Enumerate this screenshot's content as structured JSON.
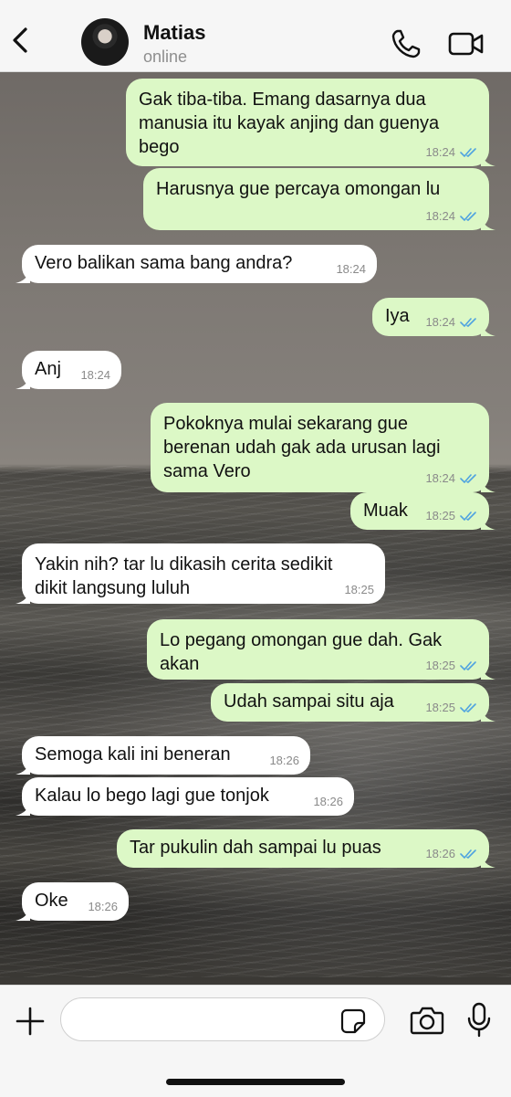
{
  "header": {
    "contact_name": "Matias",
    "status": "online",
    "icons": {
      "back": "chevron-left-icon",
      "call": "phone-icon",
      "video": "video-camera-icon"
    }
  },
  "messages": [
    {
      "dir": "out",
      "text": "Gak tiba-tiba. Emang dasarnya dua\nmanusia itu kayak anjing dan guenya\nbego",
      "time": "18:24",
      "read": true
    },
    {
      "dir": "out",
      "text": "Harusnya gue percaya omongan lu",
      "time": "18:24",
      "read": true
    },
    {
      "dir": "in",
      "text": "Vero balikan sama bang andra?",
      "time": "18:24"
    },
    {
      "dir": "out",
      "text": "Iya",
      "time": "18:24",
      "read": true
    },
    {
      "dir": "in",
      "text": "Anj",
      "time": "18:24"
    },
    {
      "dir": "out",
      "text": "Pokoknya mulai sekarang gue\nberenan udah gak ada urusan lagi\nsama Vero",
      "time": "18:24",
      "read": true
    },
    {
      "dir": "out",
      "text": "Muak",
      "time": "18:25",
      "read": true
    },
    {
      "dir": "in",
      "text": "Yakin nih? tar lu dikasih cerita sedikit\ndikit langsung luluh",
      "time": "18:25"
    },
    {
      "dir": "out",
      "text": "Lo pegang omongan gue dah. Gak\nakan",
      "time": "18:25",
      "read": true
    },
    {
      "dir": "out",
      "text": "Udah sampai situ aja",
      "time": "18:25",
      "read": true
    },
    {
      "dir": "in",
      "text": "Semoga kali ini beneran",
      "time": "18:26"
    },
    {
      "dir": "in",
      "text": "Kalau lo bego lagi gue tonjok",
      "time": "18:26"
    },
    {
      "dir": "out",
      "text": "Tar pukulin dah sampai lu puas",
      "time": "18:26",
      "read": true
    },
    {
      "dir": "in",
      "text": "Oke",
      "time": "18:26"
    }
  ],
  "composer": {
    "placeholder": "",
    "value": "",
    "icons": {
      "attach": "plus-icon",
      "sticker": "sticker-icon",
      "camera": "camera-icon",
      "mic": "microphone-icon"
    }
  },
  "colors": {
    "outgoing": "#dcf8c6",
    "incoming": "#ffffff",
    "read_ticks": "#4fa3e0"
  }
}
